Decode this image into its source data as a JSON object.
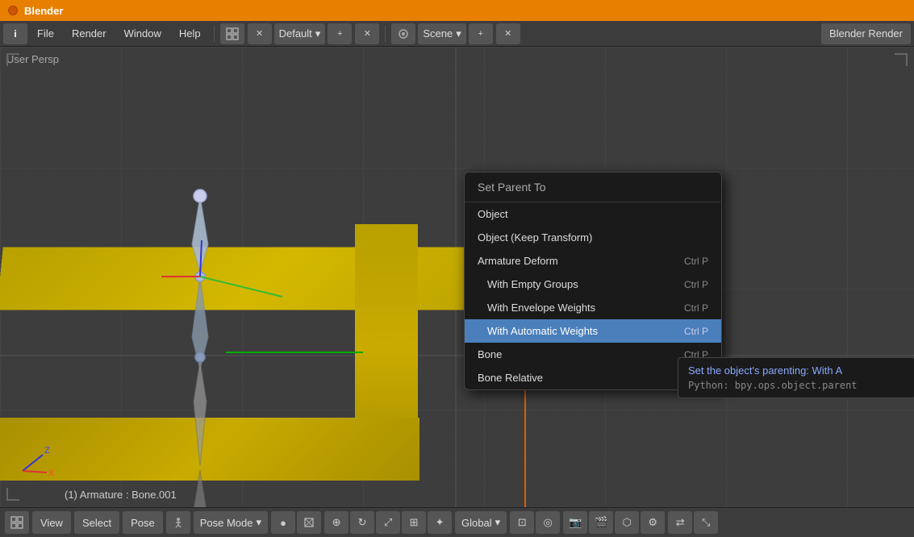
{
  "titlebar": {
    "title": "Blender"
  },
  "menubar": {
    "info_icon": "i",
    "items": [
      "File",
      "Render",
      "Window",
      "Help"
    ],
    "layout_dropdown": "Default",
    "scene_dropdown": "Scene",
    "engine_btn": "Blender Render"
  },
  "viewport": {
    "label": "User Persp",
    "armature_status": "(1) Armature : Bone.001"
  },
  "context_menu": {
    "header": "Set Parent To",
    "items": [
      {
        "label": "Object",
        "shortcut": "",
        "sub": false,
        "highlighted": false
      },
      {
        "label": "Object (Keep Transform)",
        "shortcut": "",
        "sub": false,
        "highlighted": false
      },
      {
        "label": "Armature Deform",
        "shortcut": "Ctrl P",
        "sub": false,
        "highlighted": false
      },
      {
        "label": "With Empty Groups",
        "shortcut": "Ctrl P",
        "sub": true,
        "highlighted": false
      },
      {
        "label": "With Envelope Weights",
        "shortcut": "Ctrl P",
        "sub": true,
        "highlighted": false
      },
      {
        "label": "With Automatic Weights",
        "shortcut": "Ctrl P",
        "sub": true,
        "highlighted": true
      },
      {
        "label": "Bone",
        "shortcut": "Ctrl P",
        "sub": false,
        "highlighted": false
      },
      {
        "label": "Bone Relative",
        "shortcut": "",
        "sub": false,
        "highlighted": false
      }
    ]
  },
  "tooltip": {
    "title_label": "Set the object's parenting:",
    "title_value": "With A",
    "python_label": "Python: bpy.ops.object.parent"
  },
  "bottombar": {
    "view_btn": "View",
    "select_btn": "Select",
    "pose_btn": "Pose",
    "mode_dropdown": "Pose Mode",
    "global_dropdown": "Global"
  }
}
